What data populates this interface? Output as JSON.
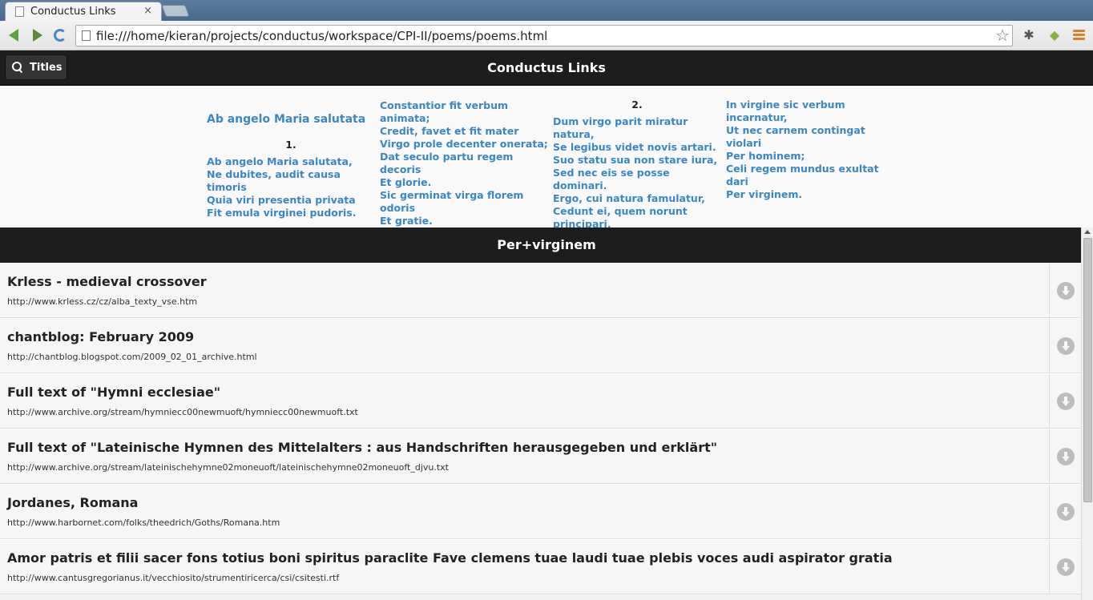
{
  "browser": {
    "tab_title": "Conductus Links",
    "tab_close": "×",
    "url": "file:///home/kieran/projects/conductus/workspace/CPI-II/poems/poems.html",
    "star": "☆"
  },
  "header": {
    "titles_button": "Titles",
    "title": "Conductus Links"
  },
  "poem": {
    "heading": "Ab angelo Maria salutata",
    "stanza1_num": "1.",
    "stanza1_lines": [
      "Ab angelo Maria salutata,",
      "Ne dubites, audit causa timoris",
      "Quia viri presentia privata",
      "Fit emula virginei pudoris."
    ],
    "col2_lines": [
      "Constantior fit verbum animata;",
      "Credit, favet et fit mater",
      "Virgo prole decenter onerata;",
      "Dat seculo partu regem decoris",
      "Et glorie.",
      "Sic germinat virga florem",
      "odoris",
      "Et gratie."
    ],
    "stanza2_num": "2.",
    "col3_lines": [
      "Dum virgo parit miratur natura,",
      "Se legibus videt novis artari.",
      "Suo statu sua non stare iura,",
      "Sed nec eis se posse dominari.",
      "Ergo, cui natura famulatur,",
      "Cedunt ei, quem norunt",
      "principari,"
    ],
    "col4_lines": [
      "In virgine sic verbum",
      "incarnatur,",
      "Ut nec carnem contingat violari",
      "Per hominem;",
      "Celi regem mundus exultat",
      "dari",
      "Per virginem."
    ]
  },
  "subheader": {
    "title": "Per+virginem"
  },
  "links": [
    {
      "title": "Krless - medieval crossover",
      "url": "http://www.krless.cz/cz/alba_texty_vse.htm"
    },
    {
      "title": "chantblog: February 2009",
      "url": "http://chantblog.blogspot.com/2009_02_01_archive.html"
    },
    {
      "title": "Full text of \"Hymni ecclesiae\"",
      "url": "http://www.archive.org/stream/hymniecc00newmuoft/hymniecc00newmuoft.txt"
    },
    {
      "title": "Full text of \"Lateinische Hymnen des Mittelalters : aus Handschriften herausgegeben und erklärt\"",
      "url": "http://www.archive.org/stream/lateinischehymne02moneuoft/lateinischehymne02moneuoft_djvu.txt"
    },
    {
      "title": "Jordanes, Romana",
      "url": "http://www.harbornet.com/folks/theedrich/Goths/Romana.htm"
    },
    {
      "title": "Amor patris et filii sacer fons totius boni spiritus paraclite Fave clemens tuae laudi tuae plebis voces audi aspirator gratia",
      "url": "http://www.cantusgregorianus.it/vecchiosito/strumentiricerca/csi/csitesti.rtf"
    }
  ],
  "icons": {
    "download": "download-icon",
    "search": "search-icon"
  }
}
